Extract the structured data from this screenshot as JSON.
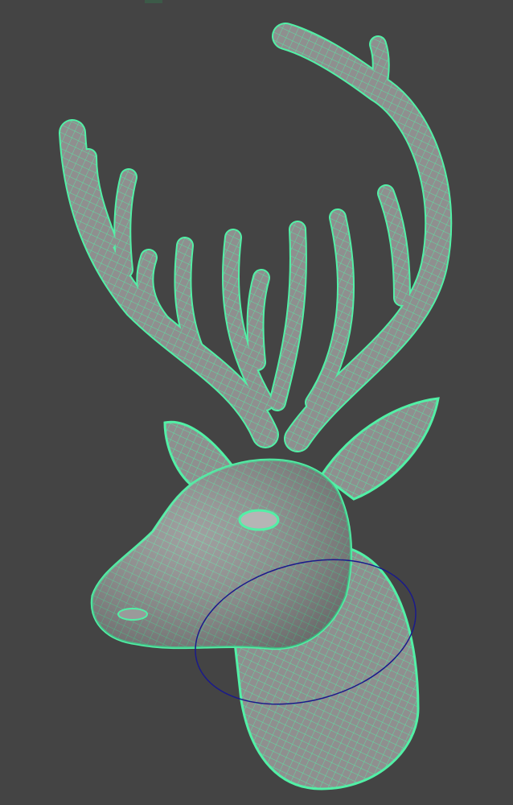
{
  "viewport": {
    "background": "#444444",
    "mesh_color": "#8f8f8f",
    "wire_color": "#52f0a6",
    "manipulator_color": "#1a1a8c"
  }
}
